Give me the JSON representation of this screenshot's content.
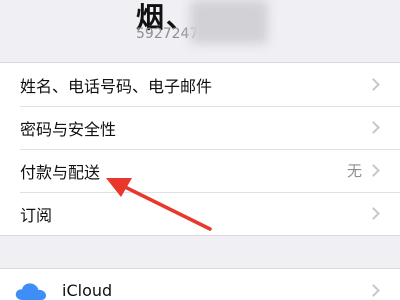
{
  "profile": {
    "name": "烟、",
    "id_partial": "5927247"
  },
  "settings_group": [
    {
      "label": "姓名、电话号码、电子邮件",
      "value": ""
    },
    {
      "label": "密码与安全性",
      "value": ""
    },
    {
      "label": "付款与配送",
      "value": "无"
    },
    {
      "label": "订阅",
      "value": ""
    }
  ],
  "services_group": [
    {
      "label": "iCloud",
      "icon": "cloud-icon"
    }
  ],
  "annotation": {
    "color": "#e8382c",
    "icon": "red-arrow-annotation"
  }
}
